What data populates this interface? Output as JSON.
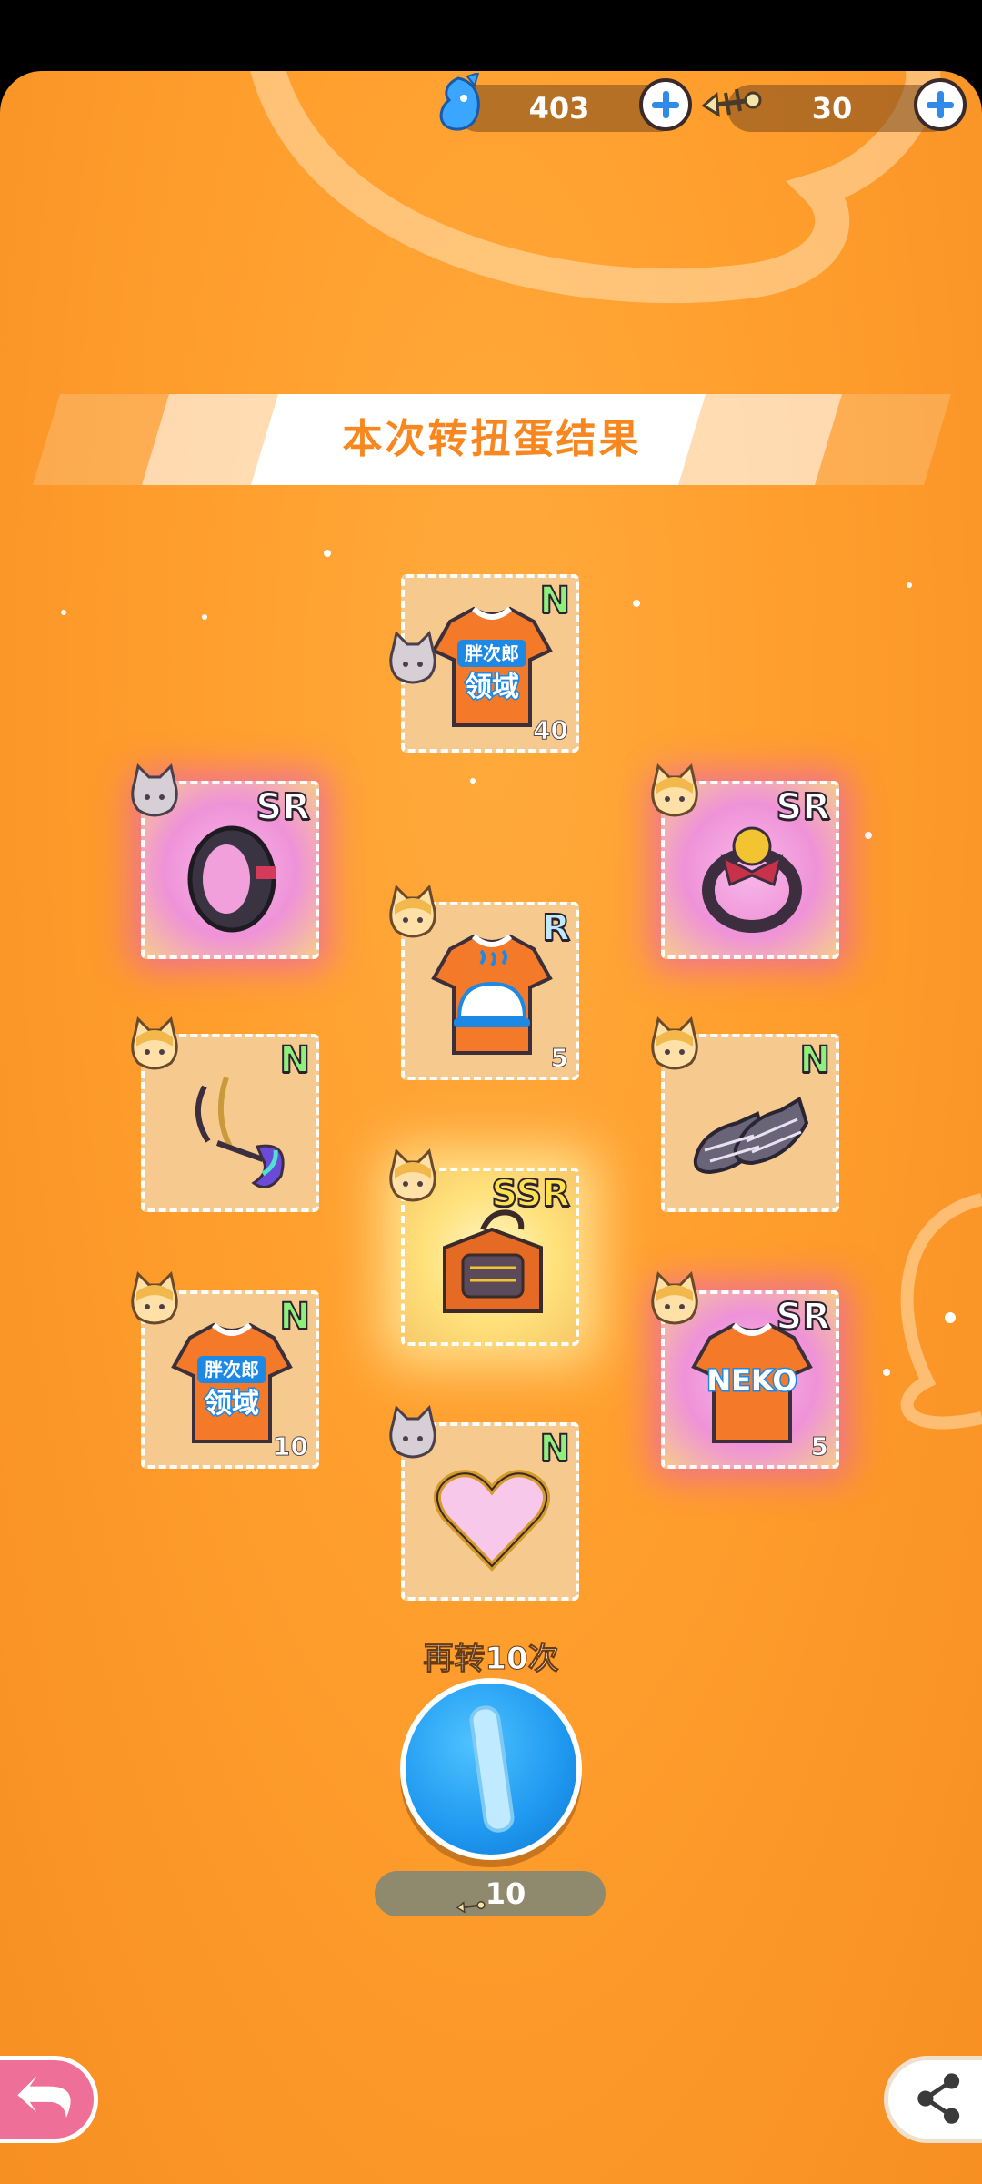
{
  "currency": {
    "gems": "403",
    "fish_tokens": "30",
    "gem_icon": "blue-fish-gem-icon",
    "fish_icon": "fishbone-icon"
  },
  "title": "本次转扭蛋结果",
  "items": [
    {
      "id": "center-1",
      "rarity": "N",
      "count": "40",
      "kind": "orange-tshirt-text",
      "avatar": "gray-cat"
    },
    {
      "id": "left-1",
      "rarity": "SR",
      "count": "",
      "kind": "black-choker",
      "avatar": "gray-cat"
    },
    {
      "id": "right-1",
      "rarity": "SR",
      "count": "",
      "kind": "bell-collar",
      "avatar": "orange-cat"
    },
    {
      "id": "center-2",
      "rarity": "R",
      "count": "5",
      "kind": "orange-tshirt-bell",
      "avatar": "orange-cat"
    },
    {
      "id": "left-2",
      "rarity": "N",
      "count": "",
      "kind": "weapon-hooks",
      "avatar": "orange-cat"
    },
    {
      "id": "right-2",
      "rarity": "N",
      "count": "",
      "kind": "plaid-shoes",
      "avatar": "orange-cat"
    },
    {
      "id": "center-3",
      "rarity": "SSR",
      "count": "",
      "kind": "cat-crate",
      "avatar": "orange-cat"
    },
    {
      "id": "left-3",
      "rarity": "N",
      "count": "10",
      "kind": "orange-tshirt-text",
      "avatar": "orange-cat"
    },
    {
      "id": "right-3",
      "rarity": "SR",
      "count": "5",
      "kind": "orange-tshirt-neko",
      "avatar": "orange-cat"
    },
    {
      "id": "center-4",
      "rarity": "N",
      "count": "",
      "kind": "heart-pin",
      "avatar": "gray-cat"
    }
  ],
  "shirt_text_1": "胖次郎",
  "shirt_text_2": "领域",
  "shirt_neko": "NEKO",
  "spin_again": {
    "label": "再转10次",
    "cost": "10"
  },
  "colors": {
    "background": "#ff9f2e",
    "title_text": "#f7871e",
    "spin_button": "#1e98f0",
    "back_button": "#ee6f97"
  }
}
